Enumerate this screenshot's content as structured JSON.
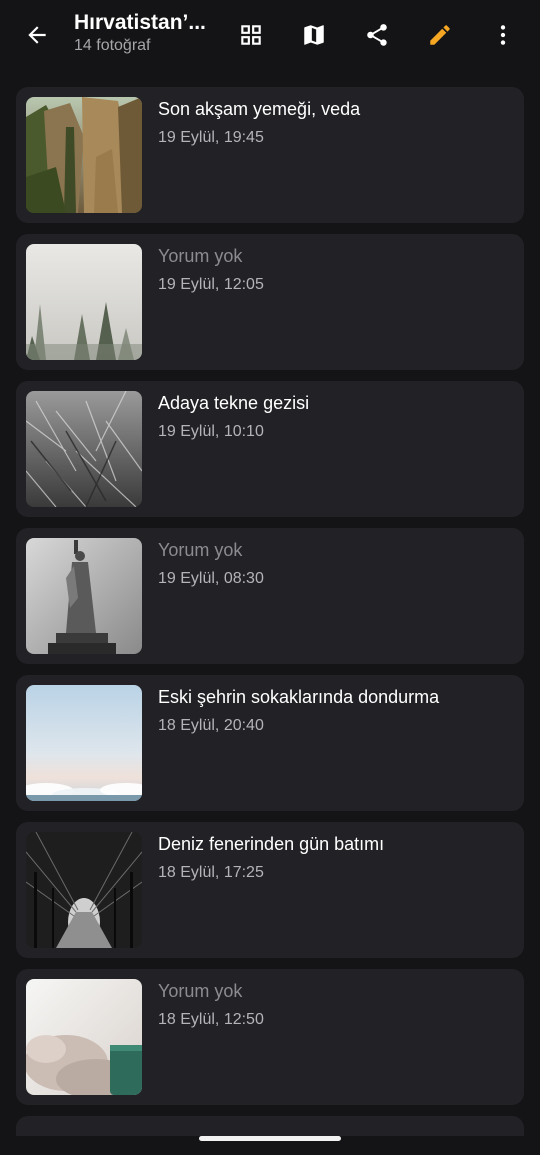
{
  "header": {
    "title": "Hırvatistan’...",
    "subtitle": "14 fotoğraf",
    "back_icon": "arrow-left-icon",
    "grid_icon": "grid-view-icon",
    "map_icon": "map-icon",
    "share_icon": "share-icon",
    "edit_icon": "pencil-icon",
    "more_icon": "more-vert-icon",
    "accent_color": "#F5A623"
  },
  "photos": [
    {
      "comment": "Son akşam yemeği, veda",
      "date": "19 Eylül, 19:45",
      "has_comment": true,
      "thumb": "rock-cliffs"
    },
    {
      "comment": "Yorum yok",
      "date": "19 Eylül, 12:05",
      "has_comment": false,
      "thumb": "foggy-forest"
    },
    {
      "comment": "Adaya tekne gezisi",
      "date": "19 Eylül, 10:10",
      "has_comment": true,
      "thumb": "dry-grass-bw"
    },
    {
      "comment": "Yorum yok",
      "date": "19 Eylül, 08:30",
      "has_comment": false,
      "thumb": "statue-of-liberty-bw"
    },
    {
      "comment": "Eski şehrin sokaklarında dondurma",
      "date": "18 Eylül, 20:40",
      "has_comment": true,
      "thumb": "sky-above-clouds"
    },
    {
      "comment": "Deniz fenerinden gün batımı",
      "date": "18 Eylül, 17:25",
      "has_comment": true,
      "thumb": "tree-tunnel-bw"
    },
    {
      "comment": "Yorum yok",
      "date": "18 Eylül, 12:50",
      "has_comment": false,
      "thumb": "blanket-and-mug"
    }
  ]
}
